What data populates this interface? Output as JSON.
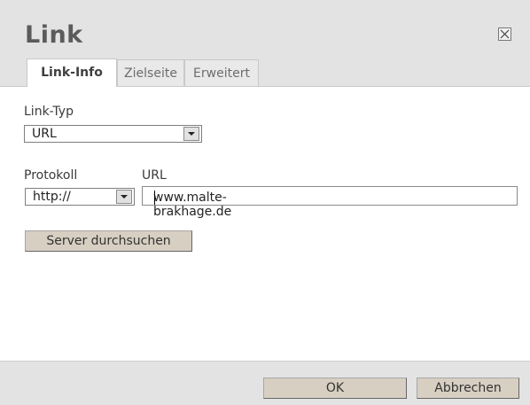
{
  "dialog": {
    "title": "Link",
    "tabs": [
      {
        "label": "Link-Info",
        "active": true
      },
      {
        "label": "Zielseite",
        "active": false
      },
      {
        "label": "Erweitert",
        "active": false
      }
    ],
    "link_type": {
      "label": "Link-Typ",
      "value": "URL"
    },
    "protocol": {
      "label": "Protokoll",
      "value": "http://"
    },
    "url": {
      "label": "URL",
      "value": "www.malte-brakhage.de"
    },
    "browse_button": "Server durchsuchen",
    "ok_button": "OK",
    "cancel_button": "Abbrechen"
  },
  "icons": {
    "close": "close-icon",
    "dropdown": "chevron-down-icon"
  },
  "colors": {
    "header": "#e3e3e3",
    "button": "#d7cfc2",
    "title": "#5b5b5b"
  }
}
